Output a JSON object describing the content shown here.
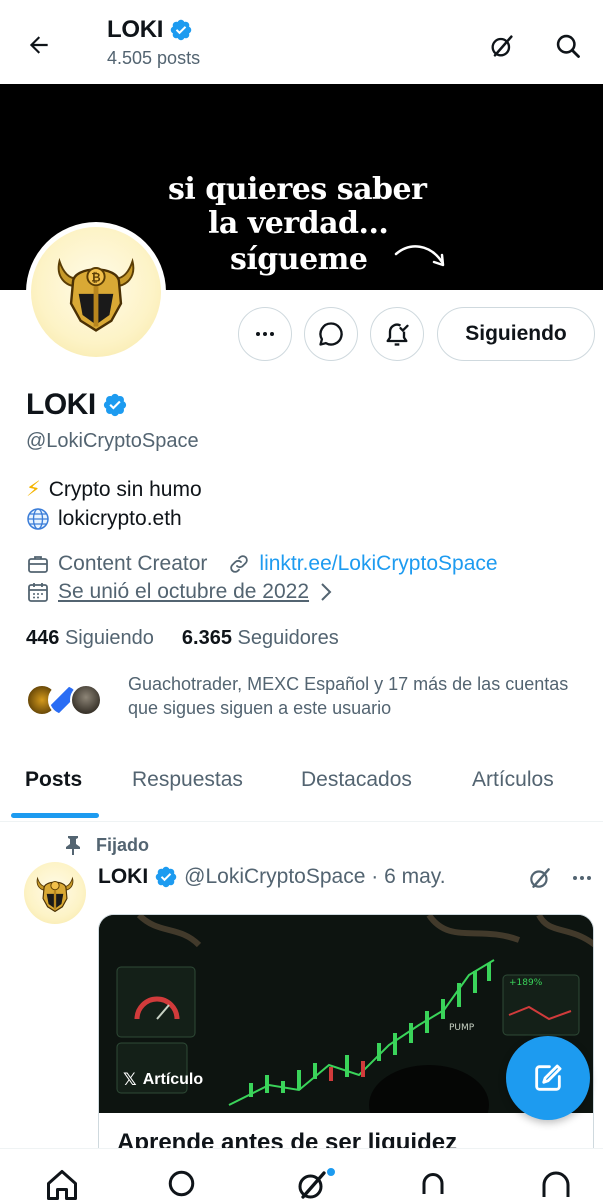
{
  "header": {
    "title": "LOKI",
    "posts_count": "4.505 posts"
  },
  "banner": {
    "line1": "si quieres saber",
    "line2": "la verdad...",
    "line3": "sígueme"
  },
  "actions": {
    "follow_label": "Siguiendo"
  },
  "profile": {
    "name": "LOKI",
    "handle": "@LokiCryptoSpace",
    "bio_line1_emoji": "⚡",
    "bio_line1": "Crypto sin humo",
    "bio_line2": "lokicrypto.eth",
    "category": "Content Creator",
    "website": "linktr.ee/LokiCryptoSpace",
    "joined": "Se unió el octubre de 2022",
    "following_count": "446",
    "following_label": "Siguiendo",
    "followers_count": "6.365",
    "followers_label": "Seguidores",
    "known_followers_line1": "Guachotrader, MEXC Español y 17 más de las cuentas",
    "known_followers_line2": "que sigues siguen a este usuario"
  },
  "tabs": [
    {
      "label": "Posts",
      "active": true
    },
    {
      "label": "Respuestas",
      "active": false
    },
    {
      "label": "Destacados",
      "active": false
    },
    {
      "label": "Artículos",
      "active": false
    }
  ],
  "pinned_post": {
    "pinned_label": "Fijado",
    "author": "LOKI",
    "handle_date": "@LokiCryptoSpace · 6 may.",
    "card_label": "Artículo",
    "card_title": "Aprende antes de ser liquidez"
  },
  "colors": {
    "accent": "#1d9bf0",
    "text": "#0f1419",
    "secondary": "#536471",
    "border": "#cfd9de"
  }
}
